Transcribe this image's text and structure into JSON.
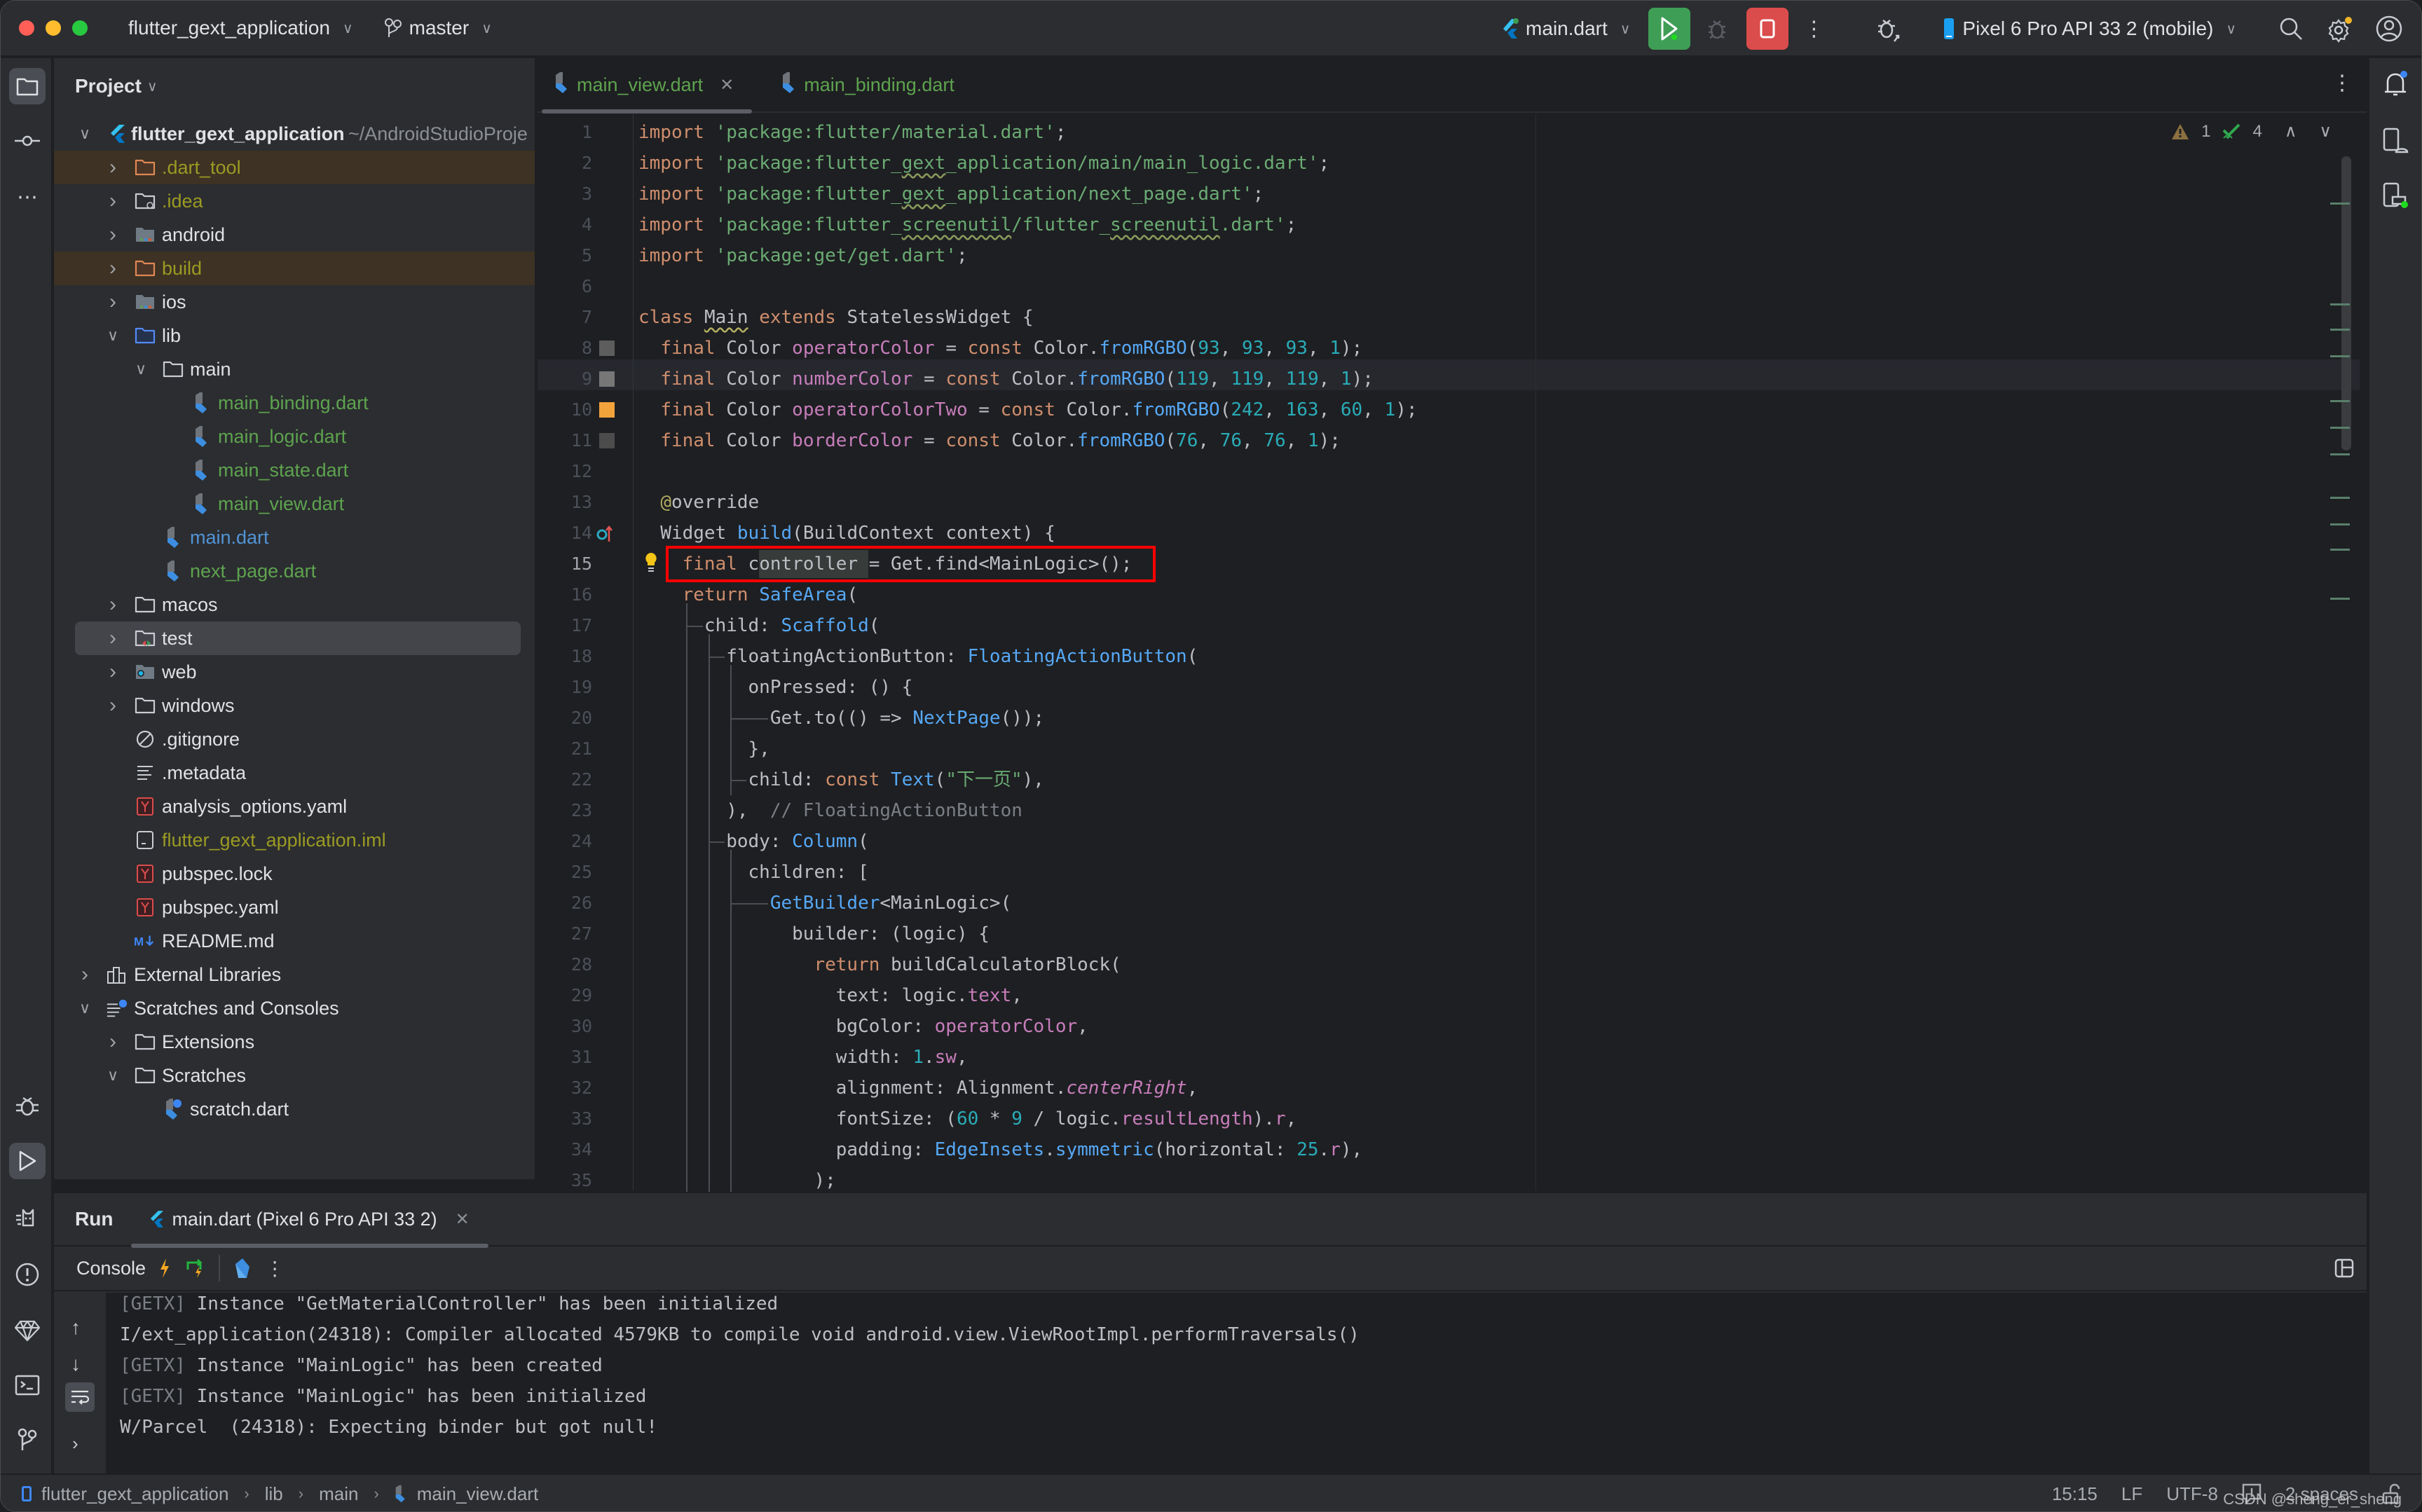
{
  "titlebar": {
    "project_name": "flutter_gext_application",
    "branch": "master",
    "run_config": "main.dart",
    "device": "Pixel 6 Pro API 33 2 (mobile)",
    "colors": {
      "close": "#ff5f57",
      "minimize": "#febc2e",
      "zoom": "#28c840",
      "run": "#3e9e55",
      "stop": "#db4c4c"
    }
  },
  "project_panel": {
    "title": "Project",
    "root": {
      "name": "flutter_gext_application",
      "path": "~/AndroidStudioProje"
    },
    "items": [
      {
        "label": ".dart_tool",
        "type": "folder-excluded",
        "expanded": false
      },
      {
        "label": ".idea",
        "type": "folder-config",
        "expanded": false
      },
      {
        "label": "android",
        "type": "folder-module",
        "expanded": false
      },
      {
        "label": "build",
        "type": "folder-excluded",
        "expanded": false
      },
      {
        "label": "ios",
        "type": "folder-module",
        "expanded": false
      },
      {
        "label": "lib",
        "type": "folder-source",
        "expanded": true
      },
      {
        "label": "main",
        "type": "folder",
        "expanded": true
      },
      {
        "label": "main_binding.dart",
        "type": "dart-file"
      },
      {
        "label": "main_logic.dart",
        "type": "dart-file"
      },
      {
        "label": "main_state.dart",
        "type": "dart-file"
      },
      {
        "label": "main_view.dart",
        "type": "dart-file"
      },
      {
        "label": "main.dart",
        "type": "dart-file"
      },
      {
        "label": "next_page.dart",
        "type": "dart-file"
      },
      {
        "label": "macos",
        "type": "folder",
        "expanded": false
      },
      {
        "label": "test",
        "type": "folder-test",
        "expanded": false,
        "selected": true
      },
      {
        "label": "web",
        "type": "folder-web",
        "expanded": false
      },
      {
        "label": "windows",
        "type": "folder",
        "expanded": false
      },
      {
        "label": ".gitignore",
        "type": "ignore-file"
      },
      {
        "label": ".metadata",
        "type": "text-file"
      },
      {
        "label": "analysis_options.yaml",
        "type": "yaml-file"
      },
      {
        "label": "flutter_gext_application.iml",
        "type": "iml-file"
      },
      {
        "label": "pubspec.lock",
        "type": "yaml-file"
      },
      {
        "label": "pubspec.yaml",
        "type": "yaml-file"
      },
      {
        "label": "README.md",
        "type": "markdown-file"
      },
      {
        "label": "External Libraries",
        "type": "libraries",
        "expanded": false
      },
      {
        "label": "Scratches and Consoles",
        "type": "scratches",
        "expanded": true
      },
      {
        "label": "Extensions",
        "type": "folder",
        "expanded": false
      },
      {
        "label": "Scratches",
        "type": "folder",
        "expanded": true
      },
      {
        "label": "scratch.dart",
        "type": "scratch-file"
      }
    ]
  },
  "editor": {
    "tabs": [
      {
        "label": "main_view.dart",
        "active": true,
        "closable": true
      },
      {
        "label": "main_binding.dart",
        "active": false
      }
    ],
    "inspections": {
      "warnings": "1",
      "weak_warnings": "4"
    },
    "current_line": 15,
    "lines": [
      "import 'package:flutter/material.dart';",
      "import 'package:flutter_gext_application/main/main_logic.dart';",
      "import 'package:flutter_gext_application/next_page.dart';",
      "import 'package:flutter_screenutil/flutter_screenutil.dart';",
      "import 'package:get/get.dart';",
      "",
      "class Main extends StatelessWidget {",
      "  final Color operatorColor = const Color.fromRGBO(93, 93, 93, 1);",
      "  final Color numberColor = const Color.fromRGBO(119, 119, 119, 1);",
      "  final Color operatorColorTwo = const Color.fromRGBO(242, 163, 60, 1);",
      "  final Color borderColor = const Color.fromRGBO(76, 76, 76, 1);",
      "",
      "  @override",
      "  Widget build(BuildContext context) {",
      "    final controller = Get.find<MainLogic>();",
      "    return SafeArea(",
      "      child: Scaffold(",
      "        floatingActionButton: FloatingActionButton(",
      "          onPressed: () {",
      "            Get.to(() => NextPage());",
      "          },",
      "          child: const Text(\"下一页\"),",
      "        ),  // FloatingActionButton",
      "        body: Column(",
      "          children: [",
      "            GetBuilder<MainLogic>(",
      "              builder: (logic) {",
      "                return buildCalculatorBlock(",
      "                  text: logic.text,",
      "                  bgColor: operatorColor,",
      "                  width: 1.sw,",
      "                  alignment: Alignment.centerRight,",
      "                  fontSize: (60 * 9 / logic.resultLength).r,",
      "                  padding: EdgeInsets.symmetric(horizontal: 25.r),",
      "                );"
    ],
    "color_swatches": [
      {
        "line": 8,
        "color": "#5d5d5d"
      },
      {
        "line": 9,
        "color": "#777777"
      },
      {
        "line": 10,
        "color": "#f2a33c"
      },
      {
        "line": 11,
        "color": "#4c4c4c"
      }
    ]
  },
  "run_panel": {
    "title": "Run",
    "tab_label": "main.dart (Pixel 6 Pro API 33 2)",
    "console_label": "Console",
    "lines": [
      {
        "prefix": "[GETX]",
        "text": " Instance \"GetMaterialController\" has been initialized"
      },
      {
        "prefix": "",
        "text": "I/ext_application(24318): Compiler allocated 4579KB to compile void android.view.ViewRootImpl.performTraversals()"
      },
      {
        "prefix": "[GETX]",
        "text": " Instance \"MainLogic\" has been created"
      },
      {
        "prefix": "[GETX]",
        "text": " Instance \"MainLogic\" has been initialized"
      },
      {
        "prefix": "",
        "text": "W/Parcel  (24318): Expecting binder but got null!"
      }
    ]
  },
  "statusbar": {
    "breadcrumb": [
      "flutter_gext_application",
      "lib",
      "main",
      "main_view.dart"
    ],
    "position": "15:15",
    "line_ending": "LF",
    "encoding": "UTF-8",
    "indent": "2 spaces",
    "watermark": "CSDN @sheng_er_sheng"
  }
}
